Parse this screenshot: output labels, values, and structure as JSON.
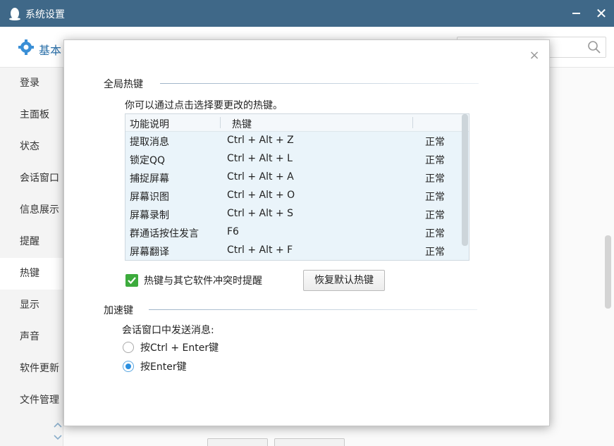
{
  "window": {
    "title": "系统设置",
    "minimize_label": "",
    "close_label": "✕"
  },
  "topbar": {
    "nav_basic": "基本",
    "search_placeholder": ""
  },
  "sidebar": {
    "items": [
      "登录",
      "主面板",
      "状态",
      "会话窗口",
      "信息展示",
      "提醒",
      "热键",
      "显示",
      "声音",
      "软件更新",
      "文件管理"
    ],
    "active_index": 6
  },
  "modal": {
    "close_label": "×",
    "global_hotkeys": {
      "title": "全局热键",
      "hint": "你可以通过点击选择要更改的热键。",
      "columns": [
        "功能说明",
        "热键",
        ""
      ],
      "rows": [
        {
          "name": "提取消息",
          "key": "Ctrl + Alt + Z",
          "status": "正常"
        },
        {
          "name": "锁定QQ",
          "key": "Ctrl + Alt + L",
          "status": "正常"
        },
        {
          "name": "捕捉屏幕",
          "key": "Ctrl + Alt + A",
          "status": "正常"
        },
        {
          "name": "屏幕识图",
          "key": "Ctrl + Alt + O",
          "status": "正常"
        },
        {
          "name": "屏幕录制",
          "key": "Ctrl + Alt + S",
          "status": "正常"
        },
        {
          "name": "群通话按住发言",
          "key": "F6",
          "status": "正常"
        },
        {
          "name": "屏幕翻译",
          "key": "Ctrl + Alt + F",
          "status": "正常"
        }
      ],
      "conflict_checkbox_label": "热键与其它软件冲突时提醒",
      "conflict_checkbox_checked": true,
      "restore_button": "恢复默认热键"
    },
    "accelerator": {
      "title": "加速键",
      "send_label": "会话窗口中发送消息:",
      "options": [
        {
          "label": "按Ctrl + Enter键",
          "checked": false
        },
        {
          "label": "按Enter键",
          "checked": true
        }
      ]
    }
  },
  "colors": {
    "titlebar": "#3f6888",
    "accent": "#2a6fa8",
    "table_bg": "#eaf4fa",
    "checkbox": "#3cab3c"
  }
}
